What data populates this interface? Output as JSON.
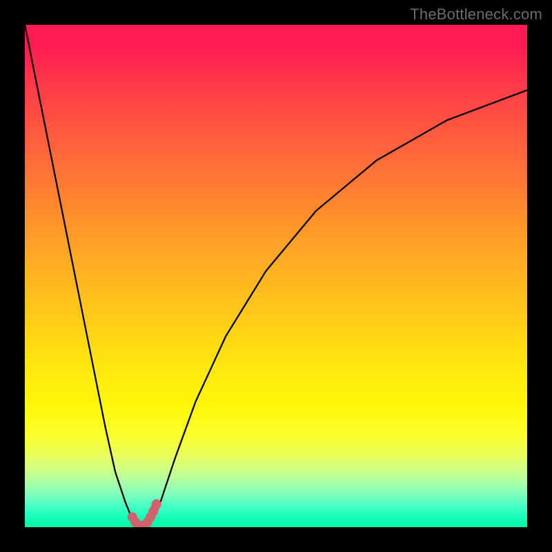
{
  "watermark": "TheBottleneck.com",
  "chart_data": {
    "type": "line",
    "title": "",
    "xlabel": "",
    "ylabel": "",
    "xlim": [
      0,
      100
    ],
    "ylim": [
      0,
      100
    ],
    "grid": false,
    "series": [
      {
        "name": "curve",
        "x": [
          0,
          4,
          8,
          12,
          16,
          18,
          20,
          21,
          22,
          23,
          23.5,
          24,
          25,
          26,
          27,
          28,
          30,
          34,
          40,
          48,
          58,
          70,
          84,
          100
        ],
        "y": [
          100,
          80,
          60,
          40,
          20,
          11,
          5,
          2.5,
          1.2,
          0.4,
          0.2,
          0.4,
          1.2,
          2.5,
          5,
          8,
          14,
          25,
          38,
          51,
          63,
          73,
          81,
          87
        ]
      }
    ],
    "highlight": {
      "name": "bottom-highlight",
      "color": "#d1626c",
      "x": [
        21.4,
        22.0,
        22.6,
        23.2,
        23.8,
        24.4,
        25.0,
        25.6,
        26.2
      ],
      "y": [
        2.0,
        1.0,
        0.4,
        0.2,
        0.4,
        1.0,
        2.0,
        3.2,
        4.6
      ]
    },
    "background_gradient": {
      "stops": [
        {
          "pos": 0,
          "color": "#ff1a52"
        },
        {
          "pos": 50,
          "color": "#ffb420"
        },
        {
          "pos": 80,
          "color": "#fff80a"
        },
        {
          "pos": 100,
          "color": "#00f5a1"
        }
      ]
    }
  }
}
